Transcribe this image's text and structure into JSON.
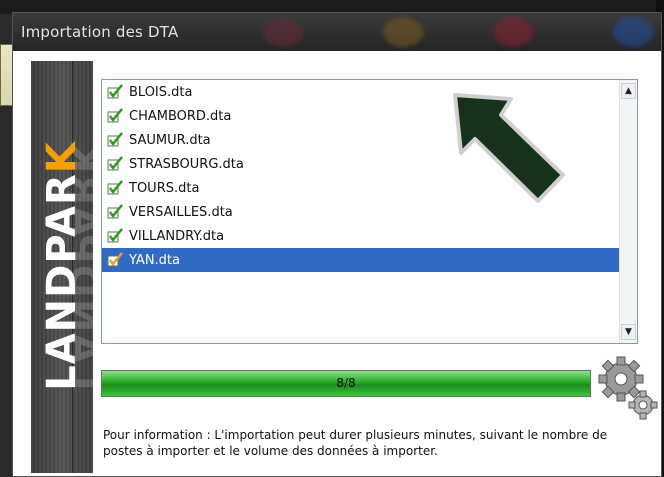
{
  "window": {
    "title": "Importation des DTA"
  },
  "brand": {
    "name_main": "LANDPAR",
    "name_accent": "K",
    "accent_color": "#f5a000"
  },
  "file_list": {
    "items": [
      {
        "label": "BLOIS.dta",
        "checked": true,
        "selected": false
      },
      {
        "label": "CHAMBORD.dta",
        "checked": true,
        "selected": false
      },
      {
        "label": "SAUMUR.dta",
        "checked": true,
        "selected": false
      },
      {
        "label": "STRASBOURG.dta",
        "checked": true,
        "selected": false
      },
      {
        "label": "TOURS.dta",
        "checked": true,
        "selected": false
      },
      {
        "label": "VERSAILLES.dta",
        "checked": true,
        "selected": false
      },
      {
        "label": "VILLANDRY.dta",
        "checked": true,
        "selected": false
      },
      {
        "label": "YAN.dta",
        "checked": true,
        "selected": true
      }
    ],
    "selection_color": "#316ac5",
    "checkmark_color": "#2f9a1f",
    "selected_checkmark_color": "#f0a020"
  },
  "progress": {
    "label": "8/8",
    "fraction": 1.0,
    "color": "#22aa22"
  },
  "info": {
    "text": "Pour information : L'importation peut durer plusieurs minutes, suivant le nombre de postes à importer et le volume des données à importer."
  },
  "icons": {
    "scroll_up": "scroll-up-arrow-icon",
    "scroll_down": "scroll-down-arrow-icon",
    "gears": "gears-icon",
    "pointer_arrow": "pointer-arrow-icon",
    "checkbox": "checkbox-icon"
  }
}
